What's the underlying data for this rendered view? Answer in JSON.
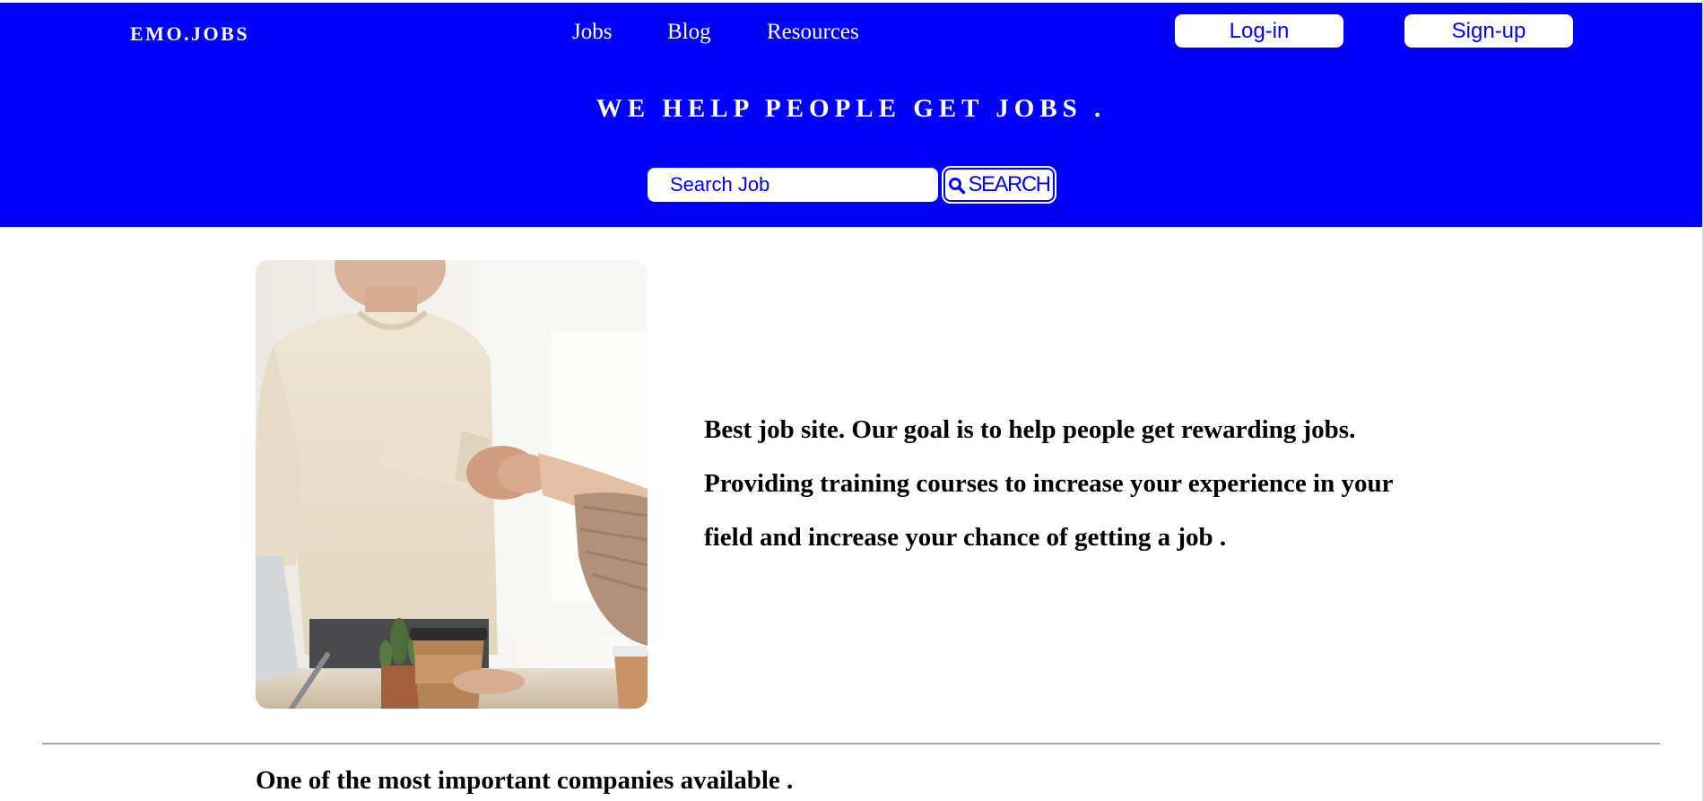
{
  "header": {
    "logo": "EMO.JOBS",
    "nav": [
      {
        "label": "Jobs"
      },
      {
        "label": "Blog"
      },
      {
        "label": "Resources"
      }
    ],
    "login_label": "Log-in",
    "signup_label": "Sign-up",
    "tagline": "WE HELP PEOPLE GET JOBS .",
    "search": {
      "placeholder": "Search Job",
      "value": "",
      "button_label": "SEARCH",
      "icon": "search-icon"
    }
  },
  "hero": {
    "image": "handshake-photo",
    "text": "Best job site. Our goal is to help people get rewarding jobs. Providing training courses to increase your experience in your field and increase your chance of getting a job ."
  },
  "companies": {
    "heading": "One of the most important companies available ."
  },
  "colors": {
    "brand_blue": "#0000ff",
    "background": "#ffffff",
    "text": "#000000",
    "divider": "#a9a9a9"
  }
}
